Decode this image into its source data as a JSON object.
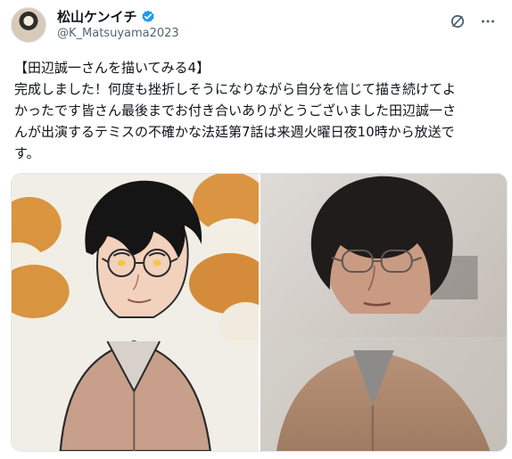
{
  "author": {
    "name": "松山ケンイチ",
    "handle": "@K_Matsuyama2023"
  },
  "post": {
    "text_lines": [
      "【田辺誠一さんを描いてみる4】",
      "完成しました！何度も挫折しそうになりながら自分を信じて描き続けてよ",
      "かったです皆さん最後までお付き合いありがとうございました田辺誠一さ",
      "んが出演するテミスの不確かな法廷第7話は来週火曜日夜10時から放送で",
      "す。"
    ]
  },
  "icons": {
    "verified": "verified-badge-icon",
    "grok": "grok-icon",
    "more": "more-icon"
  },
  "colors": {
    "text": "#0f1419",
    "secondary": "#536471",
    "verified_blue": "#1d9bf0",
    "border": "#e1e8ed"
  },
  "media": {
    "left_panel": "illustration",
    "right_panel": "photo"
  }
}
